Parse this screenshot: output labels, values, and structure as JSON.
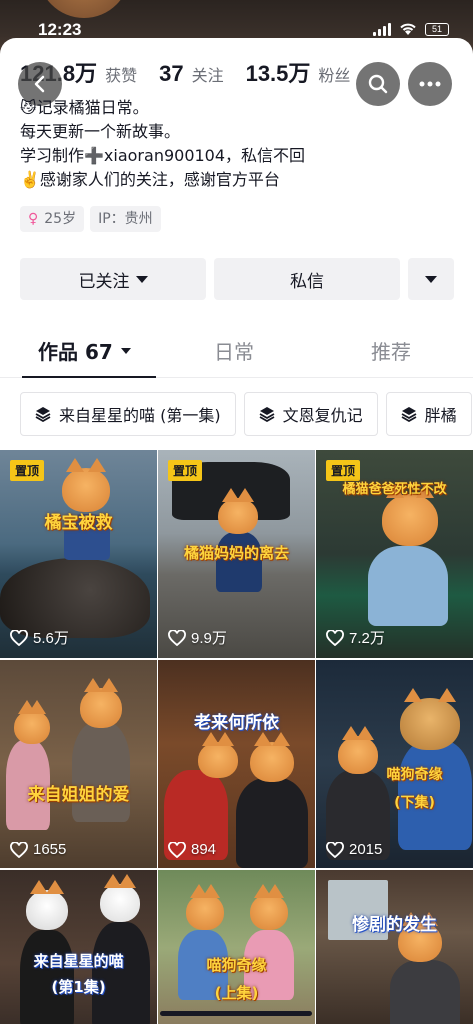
{
  "status": {
    "time": "12:23",
    "battery": "51"
  },
  "stats": [
    {
      "num": "121.8万",
      "label": "获赞"
    },
    {
      "num": "37",
      "label": "关注"
    },
    {
      "num": "13.5万",
      "label": "粉丝"
    }
  ],
  "bio": [
    "😼记录橘猫日常。",
    "每天更新一个新故事。",
    "学习制作➕xiaoran900104，私信不回",
    "✌️感谢家人们的关注，感谢官方平台"
  ],
  "tags": {
    "gender_icon": "♀",
    "age": "25岁",
    "ip": "IP：贵州"
  },
  "actions": {
    "follow": "已关注",
    "message": "私信"
  },
  "tabs": {
    "works": "作品 67",
    "daily": "日常",
    "recommend": "推荐"
  },
  "collections": [
    "来自星星的喵 (第一集)",
    "文恩复仇记",
    "胖橘"
  ],
  "grid": [
    {
      "pinned": "置顶",
      "caption": "橘宝被救",
      "likes": "5.6万"
    },
    {
      "pinned": "置顶",
      "caption": "橘猫妈妈的离去",
      "likes": "9.9万"
    },
    {
      "pinned": "置顶",
      "caption": "橘猫爸爸死性不改",
      "likes": "7.2万"
    },
    {
      "caption": "来自姐姐的爱",
      "likes": "1655"
    },
    {
      "caption": "老来何所依",
      "likes": "894"
    },
    {
      "caption": "喵狗奇缘",
      "caption2": "(下集)",
      "likes": "2015"
    },
    {
      "caption": "来自星星的喵",
      "caption2": "(第1集)"
    },
    {
      "caption": "喵狗奇缘",
      "caption2": "(上集)"
    },
    {
      "caption": "惨剧的发生"
    }
  ],
  "icons": [
    "back-icon",
    "search-icon",
    "more-icon",
    "heart-icon",
    "collection-stack-icon",
    "wifi-icon",
    "signal-icon",
    "battery-icon"
  ]
}
